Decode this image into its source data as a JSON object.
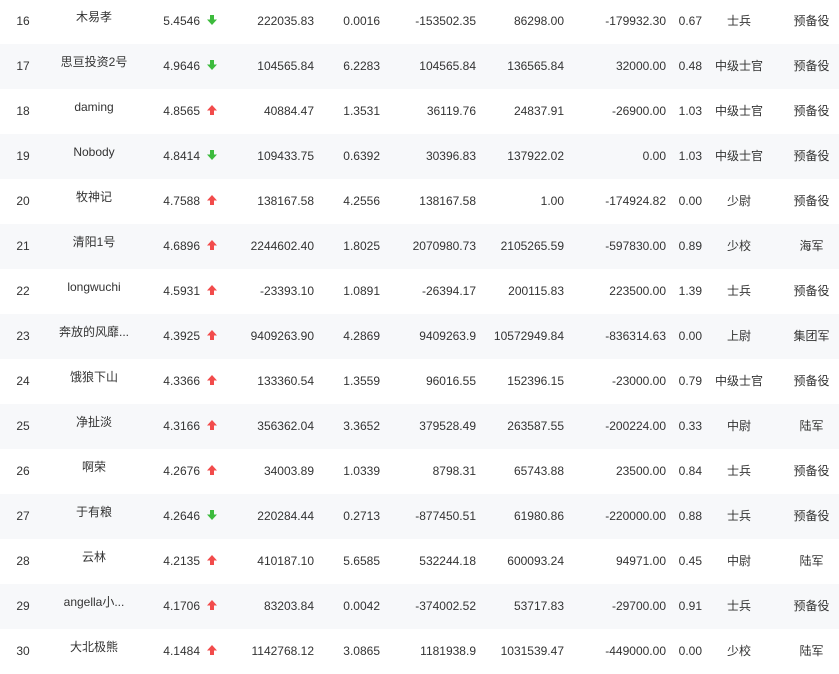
{
  "colors": {
    "up": "#f24b4b",
    "down": "#3dbb3d",
    "alt_row": "#f7f8fa"
  },
  "rows": [
    {
      "rank": "16",
      "name": "木易孝",
      "score": "5.4546",
      "trend": "down",
      "v1": "222035.83",
      "v2": "0.0016",
      "v3": "-153502.35",
      "v4": "86298.00",
      "v5": "-179932.30",
      "v6": "0.67",
      "rank_title": "士兵",
      "type": "预备役"
    },
    {
      "rank": "17",
      "name": "思亘投资2号",
      "score": "4.9646",
      "trend": "down",
      "v1": "104565.84",
      "v2": "6.2283",
      "v3": "104565.84",
      "v4": "136565.84",
      "v5": "32000.00",
      "v6": "0.48",
      "rank_title": "中级士官",
      "type": "预备役"
    },
    {
      "rank": "18",
      "name": "daming",
      "score": "4.8565",
      "trend": "up",
      "v1": "40884.47",
      "v2": "1.3531",
      "v3": "36119.76",
      "v4": "24837.91",
      "v5": "-26900.00",
      "v6": "1.03",
      "rank_title": "中级士官",
      "type": "预备役"
    },
    {
      "rank": "19",
      "name": "Nobody",
      "score": "4.8414",
      "trend": "down",
      "v1": "109433.75",
      "v2": "0.6392",
      "v3": "30396.83",
      "v4": "137922.02",
      "v5": "0.00",
      "v6": "1.03",
      "rank_title": "中级士官",
      "type": "预备役"
    },
    {
      "rank": "20",
      "name": "牧神记",
      "score": "4.7588",
      "trend": "up",
      "v1": "138167.58",
      "v2": "4.2556",
      "v3": "138167.58",
      "v4": "1.00",
      "v5": "-174924.82",
      "v6": "0.00",
      "rank_title": "少尉",
      "type": "预备役"
    },
    {
      "rank": "21",
      "name": "清阳1号",
      "score": "4.6896",
      "trend": "up",
      "v1": "2244602.40",
      "v2": "1.8025",
      "v3": "2070980.73",
      "v4": "2105265.59",
      "v5": "-597830.00",
      "v6": "0.89",
      "rank_title": "少校",
      "type": "海军"
    },
    {
      "rank": "22",
      "name": "longwuchi",
      "score": "4.5931",
      "trend": "up",
      "v1": "-23393.10",
      "v2": "1.0891",
      "v3": "-26394.17",
      "v4": "200115.83",
      "v5": "223500.00",
      "v6": "1.39",
      "rank_title": "士兵",
      "type": "预备役"
    },
    {
      "rank": "23",
      "name": "奔放的风靡...",
      "score": "4.3925",
      "trend": "up",
      "v1": "9409263.90",
      "v2": "4.2869",
      "v3": "9409263.9",
      "v4": "10572949.84",
      "v5": "-836314.63",
      "v6": "0.00",
      "rank_title": "上尉",
      "type": "集团军"
    },
    {
      "rank": "24",
      "name": "饿狼下山",
      "score": "4.3366",
      "trend": "up",
      "v1": "133360.54",
      "v2": "1.3559",
      "v3": "96016.55",
      "v4": "152396.15",
      "v5": "-23000.00",
      "v6": "0.79",
      "rank_title": "中级士官",
      "type": "预备役"
    },
    {
      "rank": "25",
      "name": "净扯淡",
      "score": "4.3166",
      "trend": "up",
      "v1": "356362.04",
      "v2": "3.3652",
      "v3": "379528.49",
      "v4": "263587.55",
      "v5": "-200224.00",
      "v6": "0.33",
      "rank_title": "中尉",
      "type": "陆军"
    },
    {
      "rank": "26",
      "name": "啊荣",
      "score": "4.2676",
      "trend": "up",
      "v1": "34003.89",
      "v2": "1.0339",
      "v3": "8798.31",
      "v4": "65743.88",
      "v5": "23500.00",
      "v6": "0.84",
      "rank_title": "士兵",
      "type": "预备役"
    },
    {
      "rank": "27",
      "name": "于有粮",
      "score": "4.2646",
      "trend": "down",
      "v1": "220284.44",
      "v2": "0.2713",
      "v3": "-877450.51",
      "v4": "61980.86",
      "v5": "-220000.00",
      "v6": "0.88",
      "rank_title": "士兵",
      "type": "预备役"
    },
    {
      "rank": "28",
      "name": "云林",
      "score": "4.2135",
      "trend": "up",
      "v1": "410187.10",
      "v2": "5.6585",
      "v3": "532244.18",
      "v4": "600093.24",
      "v5": "94971.00",
      "v6": "0.45",
      "rank_title": "中尉",
      "type": "陆军"
    },
    {
      "rank": "29",
      "name": "angella小...",
      "score": "4.1706",
      "trend": "up",
      "v1": "83203.84",
      "v2": "0.0042",
      "v3": "-374002.52",
      "v4": "53717.83",
      "v5": "-29700.00",
      "v6": "0.91",
      "rank_title": "士兵",
      "type": "预备役"
    },
    {
      "rank": "30",
      "name": "大北极熊",
      "score": "4.1484",
      "trend": "up",
      "v1": "1142768.12",
      "v2": "3.0865",
      "v3": "1181938.9",
      "v4": "1031539.47",
      "v5": "-449000.00",
      "v6": "0.00",
      "rank_title": "少校",
      "type": "陆军"
    }
  ]
}
